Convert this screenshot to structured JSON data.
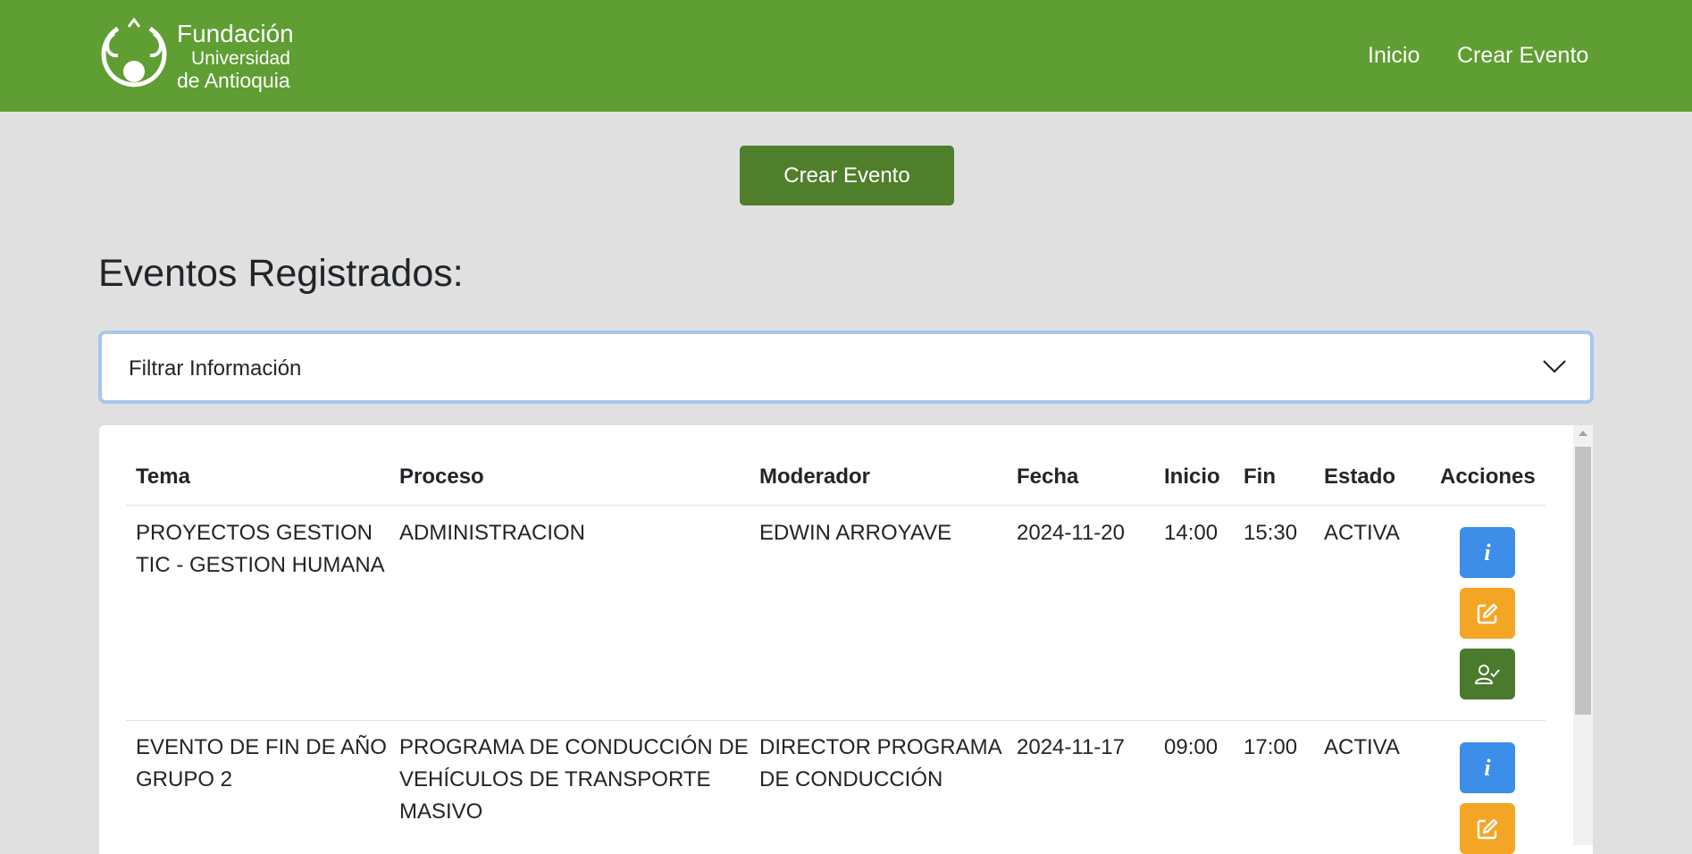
{
  "header": {
    "logo": {
      "line1": "Fundación",
      "line2": "Universidad",
      "line3": "de Antioquia"
    },
    "nav": [
      {
        "label": "Inicio"
      },
      {
        "label": "Crear Evento"
      }
    ]
  },
  "main": {
    "create_button": "Crear Evento",
    "title": "Eventos Registrados:",
    "filter_label": "Filtrar Información"
  },
  "table": {
    "headers": [
      "Tema",
      "Proceso",
      "Moderador",
      "Fecha",
      "Inicio",
      "Fin",
      "Estado",
      "Acciones"
    ],
    "rows": [
      {
        "tema": [
          "PROYECTOS GESTION",
          "TIC - GESTION HUMANA"
        ],
        "proceso": [
          "ADMINISTRACION"
        ],
        "moderador": [
          "EDWIN ARROYAVE"
        ],
        "fecha": "2024-11-20",
        "inicio": "14:00",
        "fin": "15:30",
        "estado": "ACTIVA"
      },
      {
        "tema": [
          "EVENTO DE FIN DE AÑO",
          "GRUPO 2"
        ],
        "proceso": [
          "PROGRAMA DE CONDUCCIÓN DE",
          "VEHÍCULOS DE TRANSPORTE",
          "MASIVO"
        ],
        "moderador": [
          "DIRECTOR PROGRAMA",
          "DE CONDUCCIÓN"
        ],
        "fecha": "2024-11-17",
        "inicio": "09:00",
        "fin": "17:00",
        "estado": "ACTIVA"
      }
    ],
    "action_icons": [
      "info-icon",
      "edit-icon",
      "attendance-icon"
    ]
  },
  "colors": {
    "navbar": "#5e9e32",
    "primary_button": "#4f7f2b",
    "info_button": "#3d8ee8",
    "edit_button": "#f5a526",
    "attendance_button": "#4a7a2b",
    "page_background": "#e0e0e0"
  }
}
